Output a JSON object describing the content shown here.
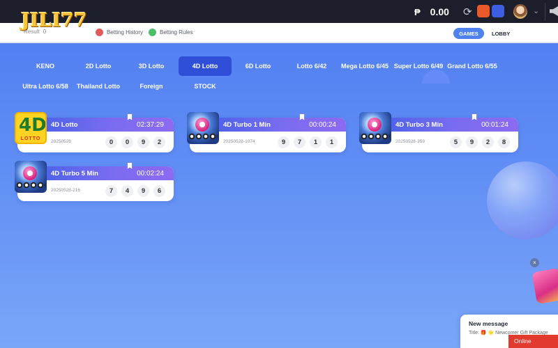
{
  "topbar": {
    "logo_text": "JILI77",
    "currency_symbol": "₱",
    "balance": "0.00",
    "icons": [
      "refresh-icon",
      "deposit-icon",
      "withdraw-icon",
      "avatar",
      "chevron-down-icon",
      "speaker-icon"
    ]
  },
  "subnav": {
    "back_label": "Result",
    "back_value": "0",
    "history_label": "Betting History",
    "rules_label": "Betting Rules",
    "games_label": "GAMES",
    "lobby_label": "LOBBY"
  },
  "tabs": [
    {
      "label": "KENO",
      "active": false
    },
    {
      "label": "2D Lotto",
      "active": false
    },
    {
      "label": "3D Lotto",
      "active": false
    },
    {
      "label": "4D Lotto",
      "active": true
    },
    {
      "label": "6D Lotto",
      "active": false
    },
    {
      "label": "Lotto 6/42",
      "active": false
    },
    {
      "label": "Mega Lotto 6/45",
      "active": false
    },
    {
      "label": "Super Lotto 6/49",
      "active": false
    },
    {
      "label": "Grand Lotto 6/55",
      "active": false
    },
    {
      "label": "Ultra Lotto 6/58",
      "active": false
    },
    {
      "label": "Thailand Lotto",
      "active": false
    },
    {
      "label": "Foreign",
      "active": false
    },
    {
      "label": "STOCK",
      "active": false
    }
  ],
  "games": [
    {
      "name": "4D Lotto",
      "time": "02:37:29",
      "draw": "20250528",
      "balls": [
        "0",
        "0",
        "9",
        "2"
      ],
      "thumb": "4d-lotto-logo",
      "thumb_big": "4D",
      "thumb_sub": "LOTTO"
    },
    {
      "name": "4D Turbo 1 Min",
      "time": "00:00:24",
      "draw": "20250528-1074",
      "balls": [
        "9",
        "7",
        "1",
        "1"
      ],
      "thumb": "turbo-balls-image"
    },
    {
      "name": "4D Turbo 3 Min",
      "time": "00:01:24",
      "draw": "20250528-359",
      "balls": [
        "5",
        "9",
        "2",
        "8"
      ],
      "thumb": "turbo-balls-image"
    },
    {
      "name": "4D Turbo 5 Min",
      "time": "00:02:24",
      "draw": "20250528-216",
      "balls": [
        "7",
        "4",
        "9",
        "6"
      ],
      "thumb": "turbo-balls-image"
    }
  ],
  "message": {
    "title": "New message",
    "body": "Title: 🎁 🌟 Newcomer Gift Package"
  },
  "online_label": "Online",
  "colors": {
    "accent": "#2f4fd8",
    "card_header": "#5a64ec",
    "online": "#e23a2e"
  }
}
